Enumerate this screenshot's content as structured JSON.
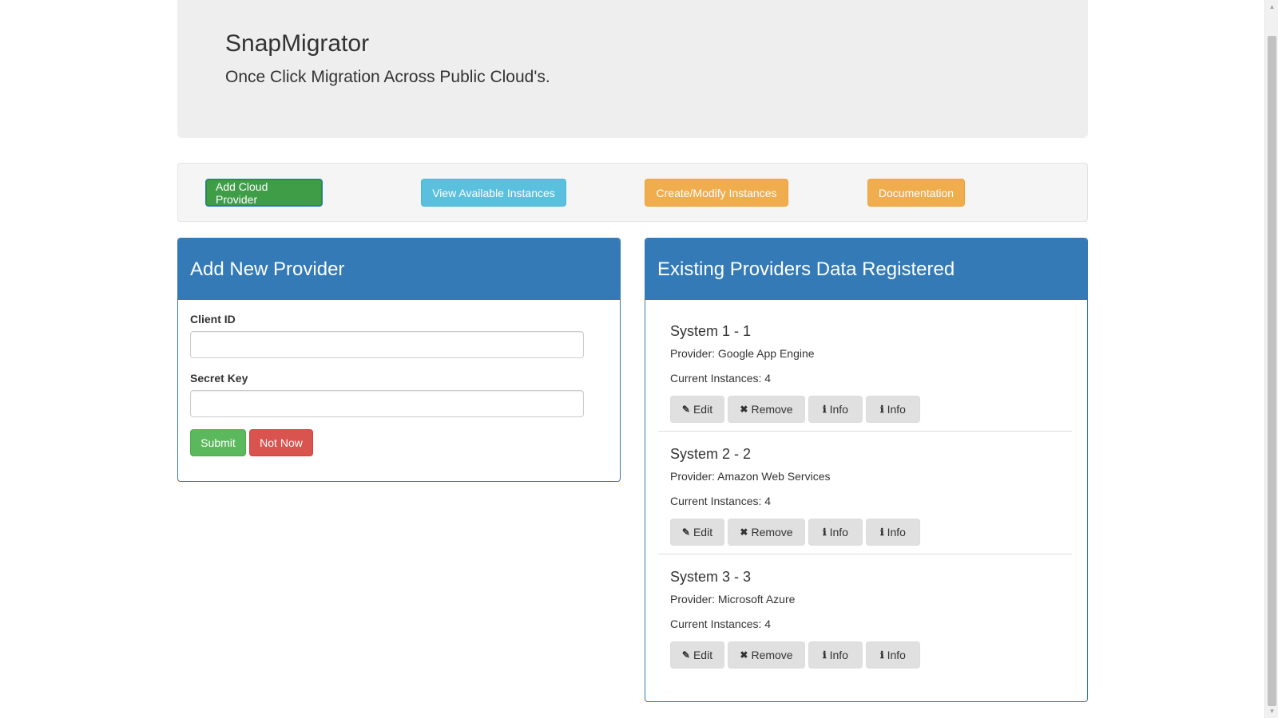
{
  "header": {
    "title": "SnapMigrator",
    "tagline": "Once Click Migration Across Public Cloud's."
  },
  "nav": {
    "add_provider": "Add Cloud Provider",
    "view_instances": "View Available Instances",
    "create_modify": "Create/Modify Instances",
    "documentation": "Documentation"
  },
  "add_panel": {
    "title": "Add New Provider",
    "client_id_label": "Client ID",
    "client_id_value": "",
    "secret_key_label": "Secret Key",
    "secret_key_value": "",
    "submit": "Submit",
    "not_now": "Not Now"
  },
  "existing_panel": {
    "title": "Existing Providers Data Registered",
    "providers": [
      {
        "name": "System 1 - 1",
        "provider": "Provider: Google App Engine",
        "instances": "Current Instances: 4",
        "edit": "Edit",
        "remove": "Remove",
        "info1": "Info",
        "info2": "Info"
      },
      {
        "name": "System 2 - 2",
        "provider": "Provider: Amazon Web Services",
        "instances": "Current Instances: 4",
        "edit": "Edit",
        "remove": "Remove",
        "info1": "Info",
        "info2": "Info"
      },
      {
        "name": "System 3 - 3",
        "provider": "Provider: Microsoft Azure",
        "instances": "Current Instances: 4",
        "edit": "Edit",
        "remove": "Remove",
        "info1": "Info",
        "info2": "Info"
      }
    ]
  },
  "icons": {
    "edit": "pencil-icon",
    "remove": "close-icon",
    "info": "info-icon"
  },
  "colors": {
    "primary": "#337ab7",
    "success": "#5cb85c",
    "danger": "#d9534f",
    "info": "#5bc0de",
    "warning": "#f0ad4e"
  }
}
